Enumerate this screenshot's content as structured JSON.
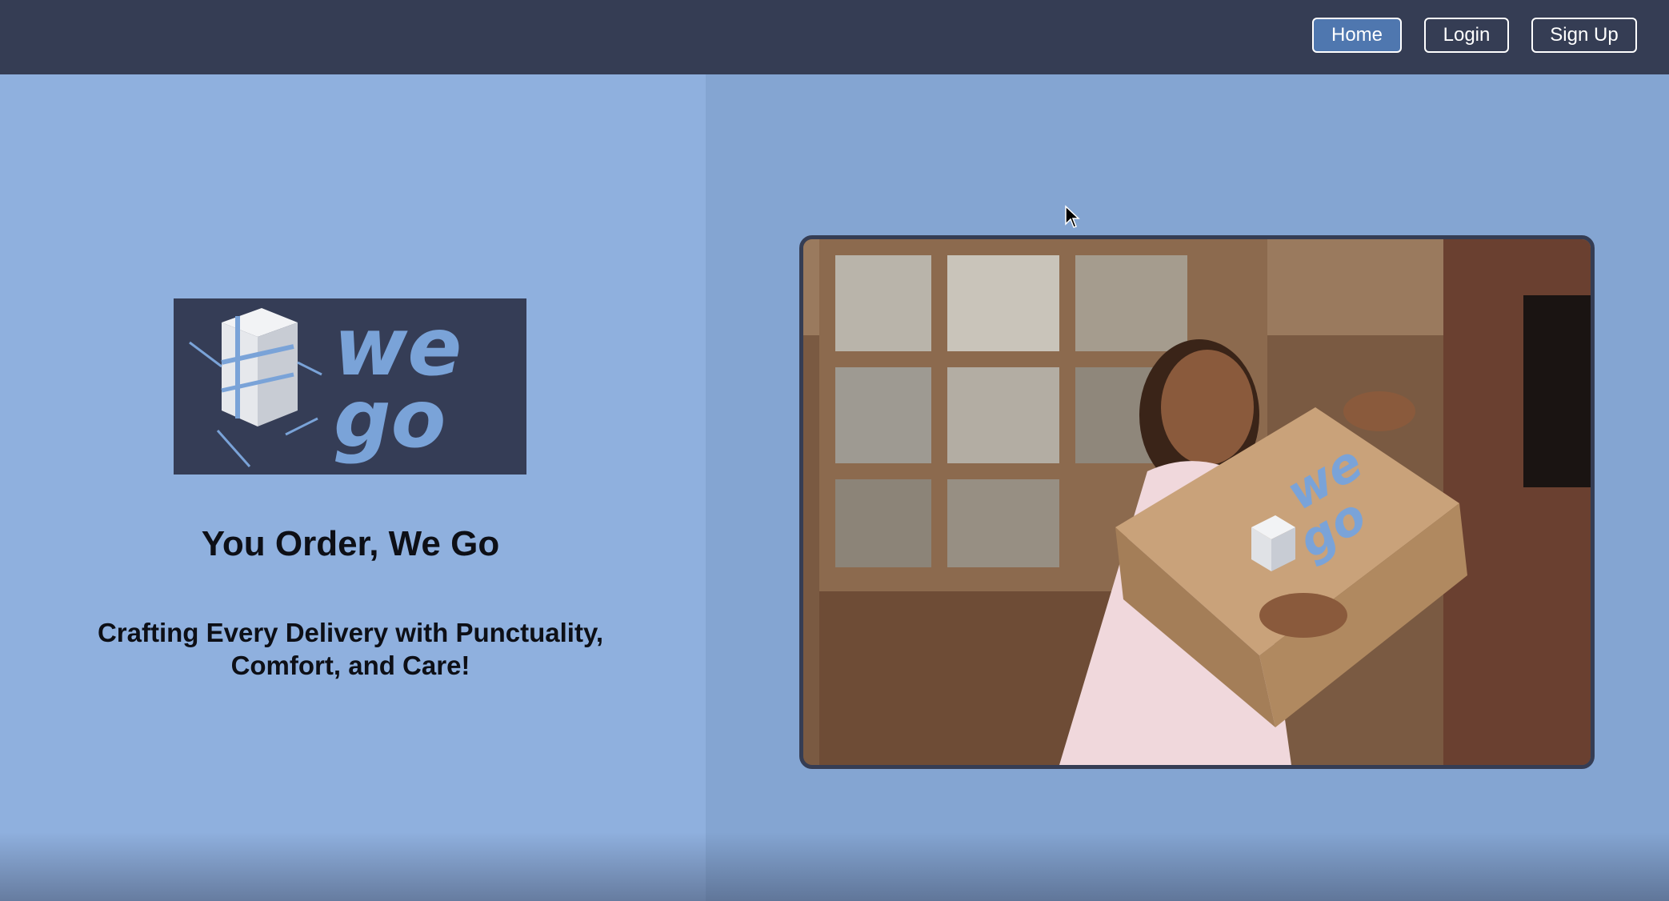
{
  "navbar": {
    "buttons": [
      {
        "label": "Home",
        "active": true
      },
      {
        "label": "Login",
        "active": false
      },
      {
        "label": "Sign Up",
        "active": false
      }
    ]
  },
  "hero": {
    "logo_text": "we go",
    "tagline": "You Order, We Go",
    "subtagline": "Crafting Every Delivery with Punctuality, Comfort, and Care!",
    "image_icon": "photo-woman-hugging-box"
  },
  "colors": {
    "navbar": "#353d54",
    "left_panel": "#8fb0de",
    "right_panel": "#84a5d2",
    "active_button": "#4f77af",
    "logo_bg": "#353d56",
    "logo_accent": "#7aa3d8"
  }
}
